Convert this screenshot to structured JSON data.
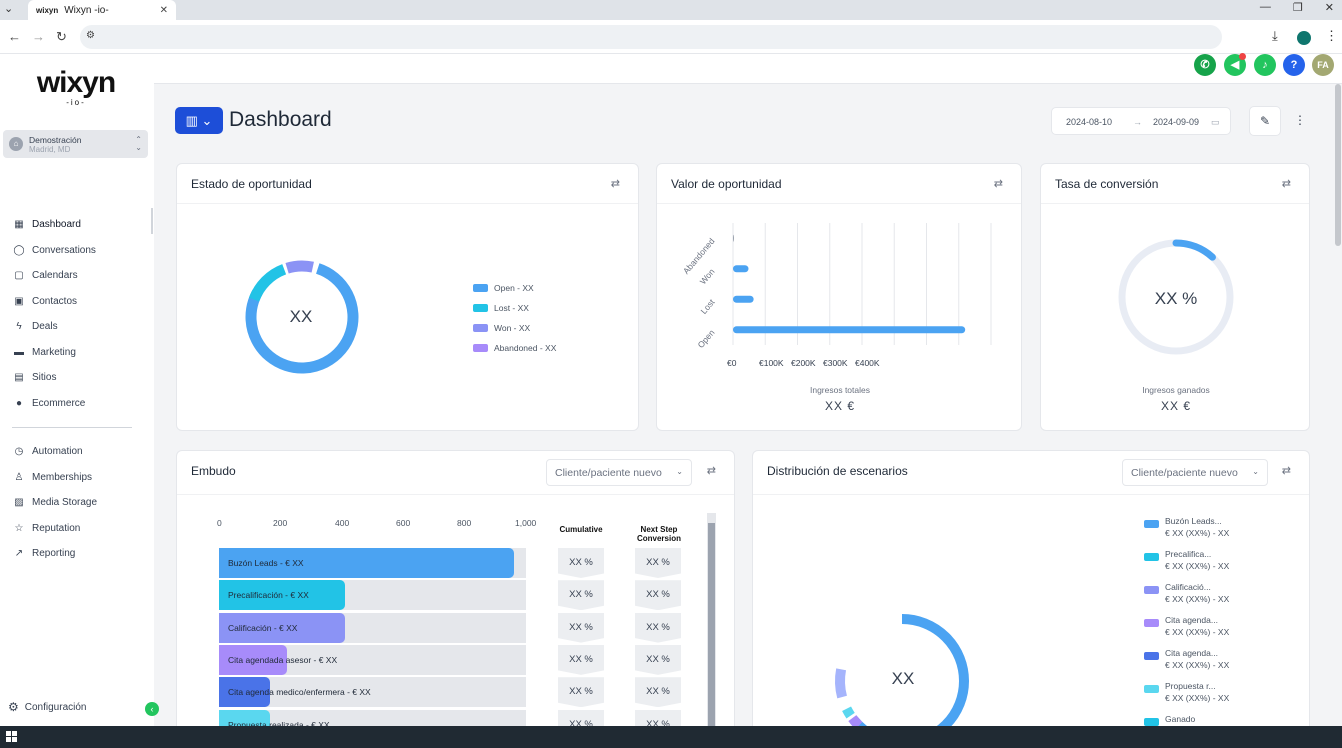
{
  "browser": {
    "tab_title": "Wixyn -io-",
    "tab_favicon": "wixyn",
    "tab_close": "✕",
    "window_buttons": [
      "—",
      "❐",
      "✕"
    ]
  },
  "logo": {
    "main": "wixyn",
    "sub": "-io-"
  },
  "account": {
    "name": "Demostración",
    "location": "Madrid, MD"
  },
  "sidebar": {
    "items": [
      {
        "label": "Dashboard",
        "icon": "grid-icon",
        "glyph": "▦"
      },
      {
        "label": "Conversations",
        "icon": "chat-icon",
        "glyph": "◯"
      },
      {
        "label": "Calendars",
        "icon": "calendar-icon",
        "glyph": "▢"
      },
      {
        "label": "Contactos",
        "icon": "contacts-icon",
        "glyph": "▣"
      },
      {
        "label": "Deals",
        "icon": "bolt-icon",
        "glyph": "ϟ"
      },
      {
        "label": "Marketing",
        "icon": "marketing-icon",
        "glyph": "▬"
      },
      {
        "label": "Sitios",
        "icon": "sites-icon",
        "glyph": "▤"
      },
      {
        "label": "Ecommerce",
        "icon": "ecommerce-icon",
        "glyph": "●"
      }
    ],
    "items2": [
      {
        "label": "Automation",
        "icon": "automation-icon",
        "glyph": "◷"
      },
      {
        "label": "Memberships",
        "icon": "memberships-icon",
        "glyph": "♙"
      },
      {
        "label": "Media Storage",
        "icon": "media-icon",
        "glyph": "▨"
      },
      {
        "label": "Reputation",
        "icon": "star-icon",
        "glyph": "☆"
      },
      {
        "label": "Reporting",
        "icon": "trend-icon",
        "glyph": "↗"
      }
    ],
    "settings_label": "Configuración"
  },
  "topbar": {
    "avatar_initials": "FA"
  },
  "header": {
    "title": "Dashboard",
    "date_from": "2024-08-10",
    "date_to": "2024-09-09"
  },
  "cards": {
    "estado": {
      "title": "Estado de oportunidad",
      "center": "XX",
      "legend": [
        {
          "label": "Open -  XX",
          "color": "#4ba3f2"
        },
        {
          "label": "Lost -  XX",
          "color": "#22c3e6"
        },
        {
          "label": "Won -  XX",
          "color": "#8b93f5"
        },
        {
          "label": "Abandoned -  XX",
          "color": "#a78bfa"
        }
      ]
    },
    "valor": {
      "title": "Valor de oportunidad",
      "caption": "Ingresos totales",
      "value": "XX    €",
      "chart_data": {
        "type": "bar",
        "orientation": "horizontal",
        "categories": [
          "Abandoned",
          "Won",
          "Lost",
          "Open"
        ],
        "values": [
          0,
          30000,
          40000,
          450000
        ],
        "xticks": [
          "€0",
          "€100K",
          "€200K",
          "€300K",
          "€400K"
        ],
        "xlim": [
          0,
          500000
        ],
        "xlabel": "",
        "ylabel": ""
      }
    },
    "tasa": {
      "title": "Tasa de conversión",
      "center": "XX %",
      "caption": "Ingresos ganados",
      "value": "XX    €"
    },
    "embudo": {
      "title": "Embudo",
      "select": "Cliente/paciente nuevo",
      "axis": [
        "0",
        "200",
        "400",
        "600",
        "800",
        "1,000"
      ],
      "col_cumulative": "Cumulative",
      "col_next": "Next Step Conversion",
      "rows": [
        {
          "label": "Buzón Leads - €  XX",
          "value": 960,
          "color": "#4ba3f2",
          "cum": "XX %",
          "next": "XX %"
        },
        {
          "label": "Precalificación - €  XX",
          "value": 410,
          "color": "#22c3e6",
          "cum": "XX %",
          "next": "XX %"
        },
        {
          "label": "Calificación - €  XX",
          "value": 410,
          "color": "#8b93f5",
          "cum": "XX %",
          "next": "XX %"
        },
        {
          "label": "Cita agendada asesor - €  XX",
          "value": 220,
          "color": "#a78bfa",
          "cum": "XX %",
          "next": "XX %"
        },
        {
          "label": "Cita agenda medico/enfermera - €  XX",
          "value": 165,
          "color": "#4a73e8",
          "cum": "XX %",
          "next": "XX %"
        },
        {
          "label": "Propuesta realizada - €  XX",
          "value": 165,
          "color": "#5ad7ef",
          "cum": "XX %",
          "next": "XX %"
        }
      ]
    },
    "distribucion": {
      "title": "Distribución de escenarios",
      "select": "Cliente/paciente nuevo",
      "center": "XX",
      "legend": [
        {
          "l1": "Buzón Leads...",
          "l2": "€ XX (XX%) - XX",
          "color": "#4ba3f2"
        },
        {
          "l1": "Precalifica...",
          "l2": "€ XX (XX%) - XX",
          "color": "#22c3e6"
        },
        {
          "l1": "Calificació...",
          "l2": "€ XX (XX%) - XX",
          "color": "#8b93f5"
        },
        {
          "l1": "Cita agenda...",
          "l2": "€ XX (XX%) - XX",
          "color": "#a78bfa"
        },
        {
          "l1": "Cita agenda...",
          "l2": "€ XX (XX%) - XX",
          "color": "#4a73e8"
        },
        {
          "l1": "Propuesta r...",
          "l2": "€ XX (XX%) - XX",
          "color": "#5ad7ef"
        },
        {
          "l1": "Ganado",
          "l2": "",
          "color": "#22c3e6"
        }
      ]
    }
  }
}
